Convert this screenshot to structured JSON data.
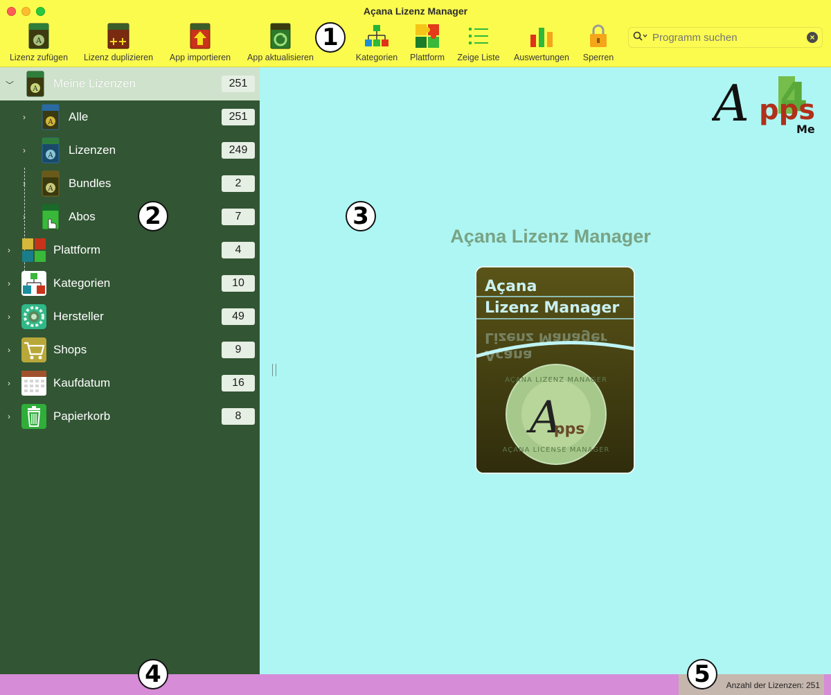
{
  "window": {
    "title": "Açana Lizenz Manager"
  },
  "toolbar": {
    "items": [
      {
        "label": "Lizenz zufügen",
        "icon": "license-box-add-icon"
      },
      {
        "label": "Lizenz duplizieren",
        "icon": "license-duplicate-icon"
      },
      {
        "label": "App importieren",
        "icon": "app-import-icon"
      },
      {
        "label": "App aktualisieren",
        "icon": "app-update-icon"
      },
      {
        "label": "Kategorien",
        "icon": "categories-hierarchy-icon"
      },
      {
        "label": "Plattform",
        "icon": "platform-puzzle-icon"
      },
      {
        "label": "Zeige Liste",
        "icon": "list-icon"
      },
      {
        "label": "Auswertungen",
        "icon": "bar-chart-icon"
      },
      {
        "label": "Sperren",
        "icon": "lock-icon"
      }
    ],
    "search": {
      "placeholder": "Programm suchen"
    }
  },
  "callouts": [
    "1",
    "2",
    "3",
    "4",
    "5"
  ],
  "sidebar": {
    "items": [
      {
        "label": "Meine Lizenzen",
        "count": "251",
        "icon": "license-box-icon"
      },
      {
        "label": "Alle",
        "count": "251",
        "icon": "license-box-icon"
      },
      {
        "label": "Lizenzen",
        "count": "249",
        "icon": "license-box-icon"
      },
      {
        "label": "Bundles",
        "count": "2",
        "icon": "license-box-icon"
      },
      {
        "label": "Abos",
        "count": "7",
        "icon": "subscription-box-icon"
      },
      {
        "label": "Plattform",
        "count": "4",
        "icon": "platform-puzzle-icon"
      },
      {
        "label": "Kategorien",
        "count": "10",
        "icon": "categories-hierarchy-icon"
      },
      {
        "label": "Hersteller",
        "count": "49",
        "icon": "manufacturer-gear-icon"
      },
      {
        "label": "Shops",
        "count": "9",
        "icon": "shopping-cart-icon"
      },
      {
        "label": "Kaufdatum",
        "count": "16",
        "icon": "calendar-icon"
      },
      {
        "label": "Papierkorb",
        "count": "8",
        "icon": "trash-icon"
      }
    ]
  },
  "main": {
    "title": "Açana Lizenz Manager",
    "logo": {
      "text_a": "A",
      "text_pps": "pps",
      "text_me": "Me",
      "numeral": "4"
    },
    "box": {
      "line1": "Açana",
      "line2": "Lizenz Manager",
      "ring_top": "AÇANA LIZENZ MANAGER",
      "ring_bottom": "AÇANA LICENSE MANAGER",
      "seal_a": "A",
      "seal_pps": "pps"
    }
  },
  "status": {
    "count_label": "Anzahl der Lizenzen: 251"
  },
  "colors": {
    "toolbar": "#fbfb4e",
    "sidebar": "#325534",
    "main": "#aef6f3",
    "statusbar": "#d78cd8",
    "title_text": "#78a385"
  }
}
